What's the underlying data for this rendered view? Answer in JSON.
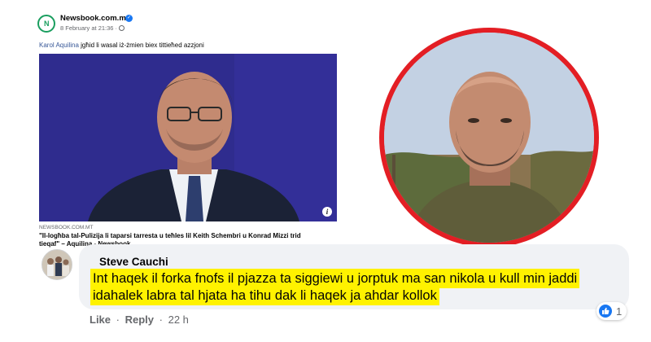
{
  "post": {
    "page_avatar_text": "N",
    "page_name": "Newsbook.com.mt",
    "time": "8 February at 21:36 · ",
    "mention": "Karol Aquilina",
    "text": " jgħid li wasal iż-żmien biex tittieħed azzjoni",
    "link_domain": "NEWSBOOK.COM.MT",
    "link_title": "\"Il-logħba tal-Pulizija li taparsi tarresta u teħles lil Keith Schembri u Konrad Mizzi trid tieqaf\" – Aquilina - Newsbook"
  },
  "comment": {
    "author": "Steve Cauchi",
    "line1": "Int haqek il forka fnofs il pjazza ta siggiewi u jorptuk ma san nikola u kull min jaddi",
    "line2": "idahalek labra tal hjata ha tihu dak li haqek ja ahdar kollok",
    "like_label": "Like",
    "reply_label": "Reply",
    "separator": "·",
    "age": "22 h",
    "reaction_count": "1"
  },
  "colors": {
    "highlight": "#fff200",
    "portrait_ring": "#e31e24",
    "facebook_blue": "#1877f2",
    "photo_background": "#2c2a86"
  },
  "icons": [
    "newsbook-logo-icon",
    "verified-badge-icon",
    "globe-icon",
    "info-icon",
    "like-reaction-icon"
  ]
}
